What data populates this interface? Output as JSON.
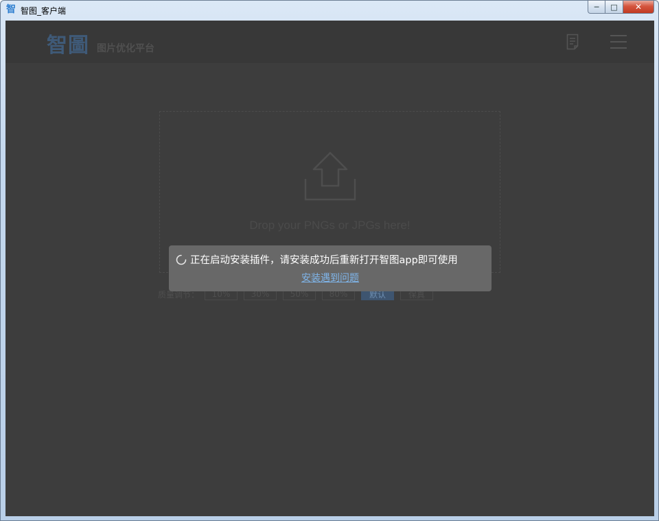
{
  "window": {
    "title": "智图_客户端",
    "app_icon_glyph": "智",
    "controls": {
      "minimize": "─",
      "maximize": "□",
      "close": "✕"
    }
  },
  "header": {
    "logo": "智圖",
    "tagline": "图片优化平台",
    "icons": {
      "doc": "document-icon",
      "menu": "hamburger-menu-icon"
    }
  },
  "dropzone": {
    "icon": "upload-arrow-icon",
    "text": "Drop your PNGs or JPGs here!"
  },
  "quality": {
    "label": "质量调节：",
    "options": [
      "10%",
      "30%",
      "50%",
      "80%",
      "默认",
      "保真"
    ],
    "selected": "默认"
  },
  "toast": {
    "message": "正在启动安装插件，请安装成功后重新打开智图app即可使用",
    "link": "安装遇到问题"
  },
  "colors": {
    "client_bg": "#3d3d3d",
    "header_bg": "#383838",
    "toast_bg": "#686868",
    "link": "#7fb5ea",
    "accent": "#3e5570"
  }
}
